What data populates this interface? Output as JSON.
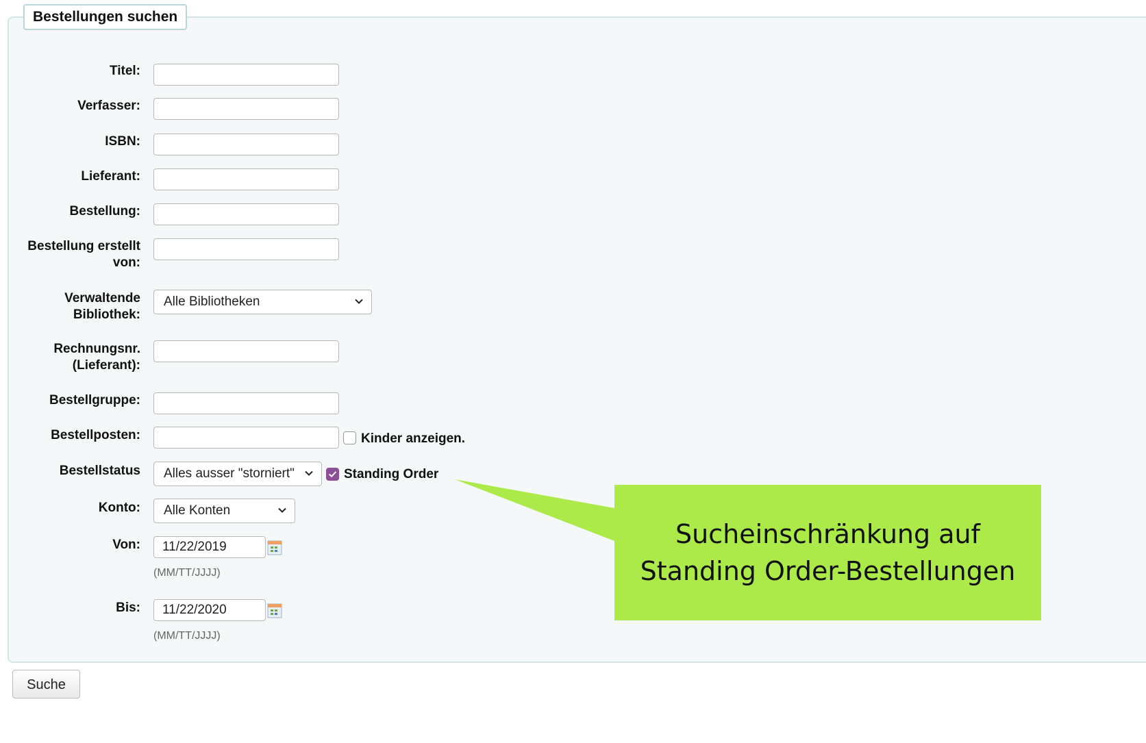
{
  "legend": "Bestellungen suchen",
  "fields": {
    "titel": "Titel:",
    "verfasser": "Verfasser:",
    "isbn": "ISBN:",
    "lieferant": "Lieferant:",
    "bestellung": "Bestellung:",
    "erstellt_line1": "Bestellung erstellt",
    "erstellt_line2": "von:",
    "bibliothek_line1": "Verwaltende",
    "bibliothek_line2": "Bibliothek:",
    "rechnung_line1": "Rechnungsnr.",
    "rechnung_line2": "(Lieferant):",
    "bestellgruppe": "Bestellgruppe:",
    "bestellposten": "Bestellposten:",
    "bestellstatus": "Bestellstatus",
    "konto": "Konto:",
    "von": "Von:",
    "bis": "Bis:"
  },
  "selects": {
    "bibliothek": "Alle Bibliotheken",
    "status": "Alles ausser \"storniert\"",
    "konto": "Alle Konten"
  },
  "checkboxes": {
    "kinder_label": "Kinder anzeigen.",
    "kinder_checked": false,
    "standing_label": "Standing Order",
    "standing_checked": true
  },
  "dates": {
    "von": "11/22/2019",
    "bis": "11/22/2020",
    "format_hint": "(MM/TT/JJJJ)"
  },
  "submit_label": "Suche",
  "callout": {
    "line1": "Sucheinschränkung auf",
    "line2": "Standing Order-Bestellungen",
    "color": "#acea4a"
  }
}
